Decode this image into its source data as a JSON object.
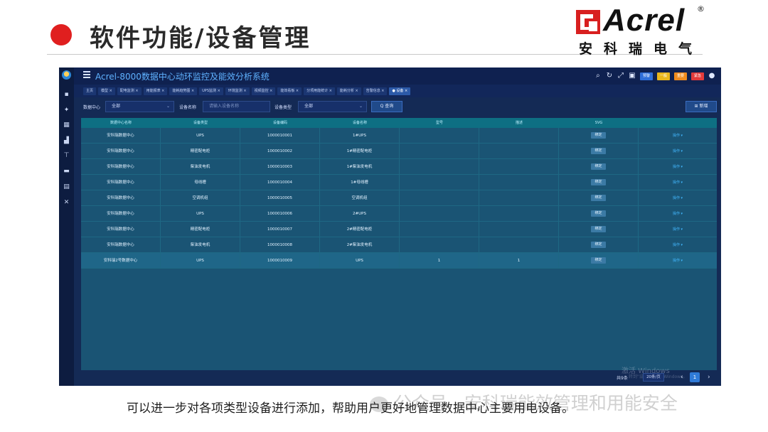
{
  "slide": {
    "title": "软件功能/设备管理",
    "logo_word": "Acrel",
    "logo_registered": "®",
    "logo_cn": "安科瑞电气",
    "caption": "可以进一步对各项类型设备进行添加，帮助用户更好地管理数据中心主要用电设备。",
    "watermark": "公众号 · 安科瑞能效管理和用能安全"
  },
  "app": {
    "title": "Acrel-8000数据中心动环监控及能效分析系统",
    "topbar_buttons": [
      {
        "label": "预警",
        "color": "#2f6fd8"
      },
      {
        "label": "一般",
        "color": "#e8b61c"
      },
      {
        "label": "重要",
        "color": "#ef8b1d"
      },
      {
        "label": "紧急",
        "color": "#e23b3b"
      }
    ],
    "tabs": [
      {
        "label": "主页"
      },
      {
        "label": "模型 ×"
      },
      {
        "label": "配电监测 ×"
      },
      {
        "label": "用能报表 ×"
      },
      {
        "label": "能耗趋势图 ×"
      },
      {
        "label": "UPS监测 ×"
      },
      {
        "label": "环境监测 ×"
      },
      {
        "label": "视频监控 ×"
      },
      {
        "label": "能效看板 ×"
      },
      {
        "label": "分项用能统计 ×"
      },
      {
        "label": "能耗分析 ×"
      },
      {
        "label": "告警信息 ×"
      },
      {
        "label": "● 设备 ×",
        "active": true
      }
    ],
    "filters": {
      "datacenter_label": "数据中心",
      "datacenter_value": "全部",
      "device_name_label": "设备名称",
      "device_name_placeholder": "请输入设备名称",
      "device_type_label": "设备类型",
      "device_type_value": "全部",
      "query_button": "Q 查询",
      "add_button": "新增"
    },
    "table": {
      "columns": [
        "数据中心名称",
        "设备类型",
        "设备编码",
        "设备名称",
        "型号",
        "描述",
        "SVG",
        ""
      ],
      "rows": [
        [
          "安科瑞数据中心",
          "UPS",
          "1000010001",
          "1#UPS",
          "",
          "",
          "绑定",
          "操作 ▾"
        ],
        [
          "安科瑞数据中心",
          "精密配电柜",
          "1000010002",
          "1#精密配电柜",
          "",
          "",
          "绑定",
          "操作 ▾"
        ],
        [
          "安科瑞数据中心",
          "柴油发电机",
          "1000010003",
          "1#柴油发电机",
          "",
          "",
          "绑定",
          "操作 ▾"
        ],
        [
          "安科瑞数据中心",
          "母线槽",
          "1000010004",
          "1#母线槽",
          "",
          "",
          "绑定",
          "操作 ▾"
        ],
        [
          "安科瑞数据中心",
          "空调机组",
          "1000010005",
          "空调机组",
          "",
          "",
          "绑定",
          "操作 ▾"
        ],
        [
          "安科瑞数据中心",
          "UPS",
          "1000010006",
          "2#UPS",
          "",
          "",
          "绑定",
          "操作 ▾"
        ],
        [
          "安科瑞数据中心",
          "精密配电柜",
          "1000010007",
          "2#精密配电柜",
          "",
          "",
          "绑定",
          "操作 ▾"
        ],
        [
          "安科瑞数据中心",
          "柴油发电机",
          "1000010008",
          "2#柴油发电机",
          "",
          "",
          "绑定",
          "操作 ▾"
        ],
        [
          "安科瑞2号数据中心",
          "UPS",
          "1000010009",
          "UPS",
          "1",
          "1",
          "绑定",
          "操作 ▾"
        ]
      ],
      "selected_row": 8
    },
    "pager": {
      "total": "共9条",
      "page_size": "20条/页",
      "current_page": "1",
      "windows_watermark": "激活 Windows",
      "windows_watermark_sub": "转到\"设置\"以激活 Windows。"
    },
    "sidebar_icons": [
      "home-icon",
      "monitor-icon",
      "gear-icon",
      "building-icon",
      "chart-icon",
      "tower-icon",
      "folder-icon",
      "report-icon",
      "wrench-icon"
    ]
  }
}
